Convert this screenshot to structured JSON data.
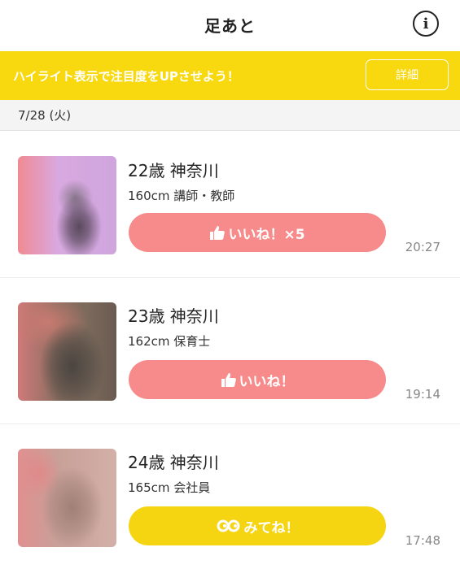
{
  "header": {
    "title": "足あと",
    "info_icon": "info-icon"
  },
  "banner": {
    "text": "ハイライト表示で注目度をUPさせよう！",
    "button_label": "詳細",
    "color": "#f8d80f"
  },
  "date_section": {
    "date": "7/28 (火)"
  },
  "items": [
    {
      "name": "22歳 神奈川",
      "detail": "160cm 講師・教師",
      "button_label": "いいね！×5",
      "button_icon": "thumbs-up-icon",
      "button_color": "#f78a8a",
      "time": "20:27"
    },
    {
      "name": "23歳 神奈川",
      "detail": "162cm 保育士",
      "button_label": "いいね！",
      "button_icon": "thumbs-up-icon",
      "button_color": "#f78a8a",
      "time": "19:14"
    },
    {
      "name": "24歳 神奈川",
      "detail": "165cm 会社員",
      "button_label": "みてね！",
      "button_icon": "eyes-icon",
      "button_color": "#f5d412",
      "time": "17:48"
    }
  ]
}
